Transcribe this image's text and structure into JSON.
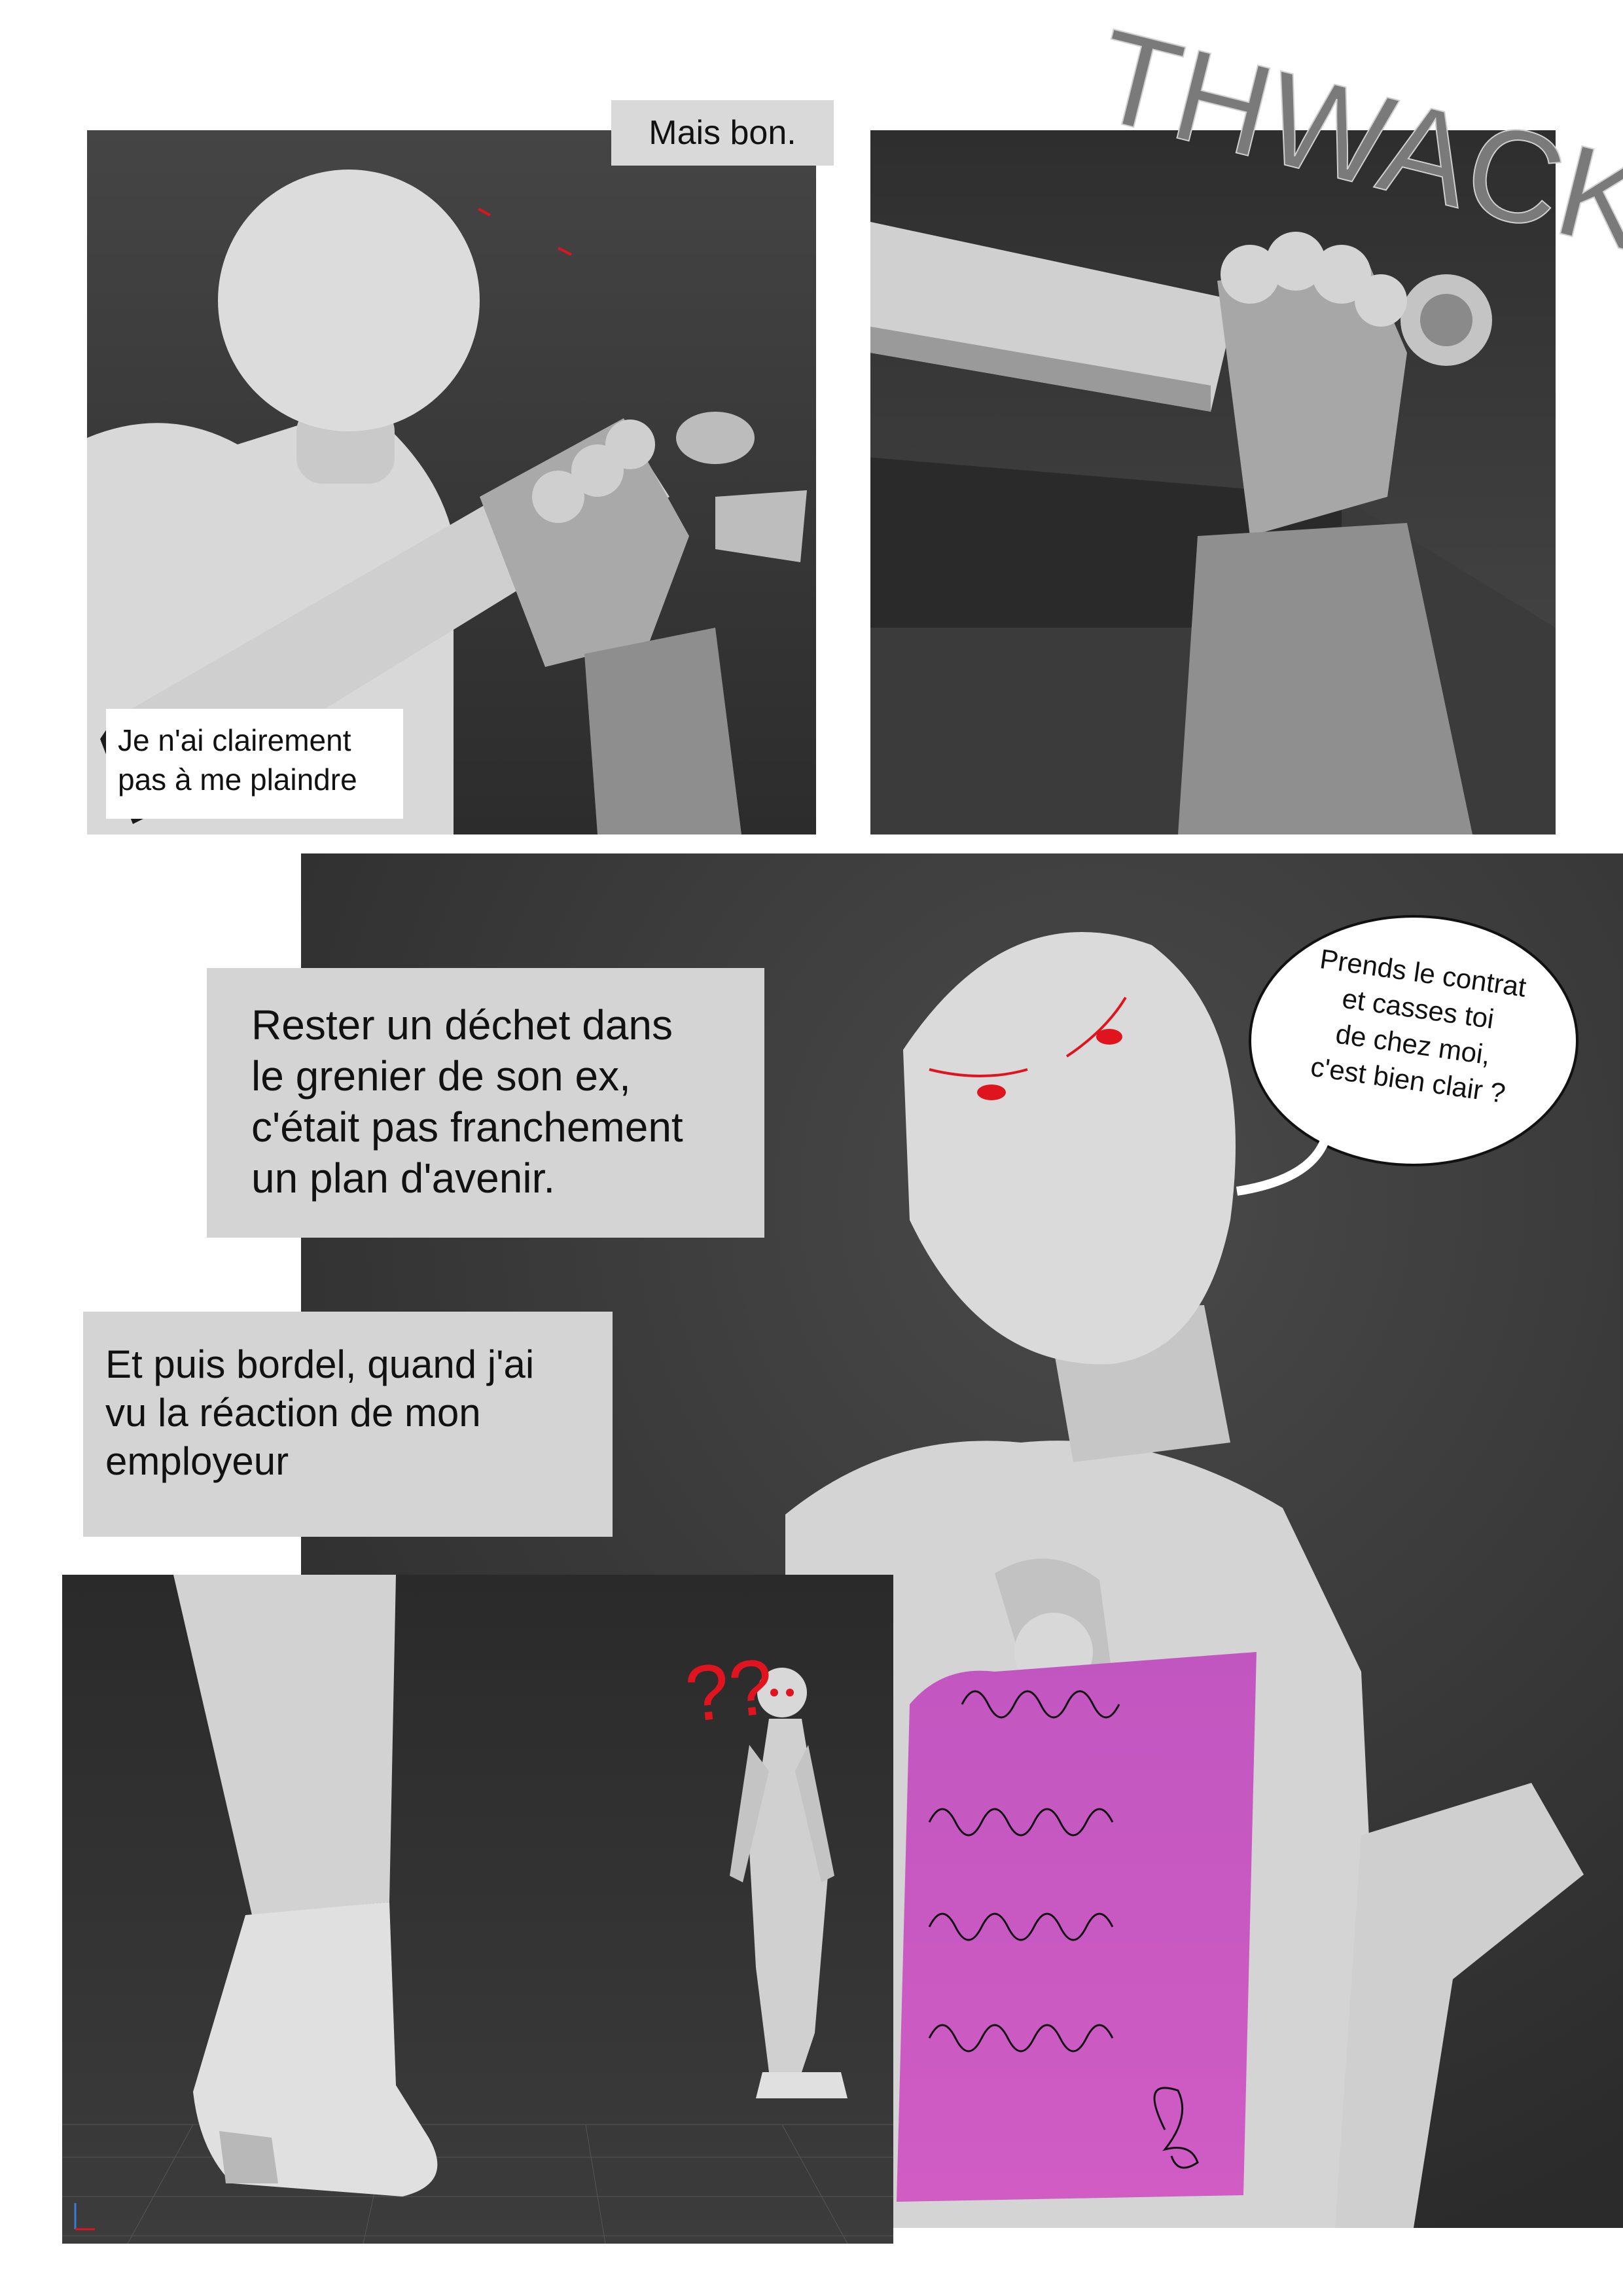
{
  "panel1": {
    "caption_top": "Mais bon.",
    "caption_bottom_lines": [
      "Je n'ai clairement",
      "pas à me plaindre"
    ]
  },
  "panel2": {
    "sfx": "THWACK"
  },
  "panel3": {
    "caption_lines": [
      "Rester un déchet dans",
      "le grenier de son ex,",
      "c'était pas franchement",
      "un plan d'avenir."
    ],
    "speech_lines": [
      "Prends le contrat",
      "et casses toi",
      "de chez moi,",
      "c'est bien clair ?"
    ]
  },
  "panel4": {
    "caption_lines": [
      "Et puis bordel, quand j'ai",
      "vu la réaction de mon",
      "employeur"
    ],
    "question_marks": "??"
  },
  "colors": {
    "panel_bg": "#3a3a3a",
    "mannequin": "#d6d6d6",
    "caption_bg": "#d4d4d4",
    "eyes": "#e0141e",
    "contract": "#cc57c0"
  }
}
